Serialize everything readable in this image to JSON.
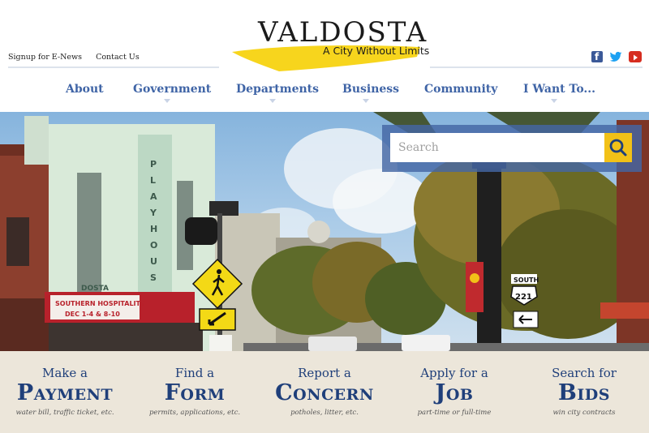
{
  "header": {
    "logo_title": "VALDOSTA",
    "logo_tagline": "A City Without Limits",
    "utility_links": [
      "Signup for E-News",
      "Contact Us"
    ],
    "social": [
      "facebook-icon",
      "twitter-icon",
      "youtube-icon"
    ]
  },
  "nav": {
    "items": [
      {
        "label": "About"
      },
      {
        "label": "Government"
      },
      {
        "label": "Departments"
      },
      {
        "label": "Business"
      },
      {
        "label": "Community"
      },
      {
        "label": "I Want To..."
      }
    ]
  },
  "search": {
    "placeholder": "Search"
  },
  "hero": {
    "marquee_line1": "SOUTHERN HOSPITALITY",
    "marquee_line2": "DEC 1-4 & 8-10",
    "theater_sign": "PLAYHOUSE",
    "theater_name": "DOSTA",
    "route_sign_top": "SOUTH",
    "route_sign_number": "221"
  },
  "cards": [
    {
      "top": "Make a",
      "big": "Payment",
      "sub": "water bill, traffic ticket, etc."
    },
    {
      "top": "Find a",
      "big": "Form",
      "sub": "permits, applications, etc."
    },
    {
      "top": "Report a",
      "big": "Concern",
      "sub": "potholes, litter, etc."
    },
    {
      "top": "Apply for a",
      "big": "Job",
      "sub": "part-time or full-time"
    },
    {
      "top": "Search for",
      "big": "Bids",
      "sub": "win city contracts"
    }
  ],
  "colors": {
    "brand_blue": "#1f3f7a",
    "nav_blue": "#3f64a6",
    "accent_yellow": "#f2c118",
    "card_background": "#ece6da"
  }
}
